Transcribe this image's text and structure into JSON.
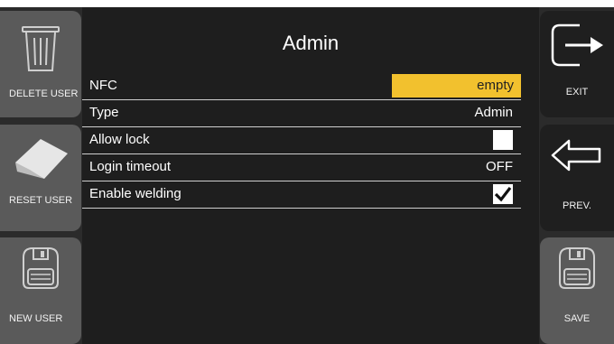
{
  "screen_title": "Admin",
  "left_buttons": [
    {
      "label": "DELETE USER",
      "icon": "trash-icon"
    },
    {
      "label": "RESET USER",
      "icon": "eraser-icon"
    },
    {
      "label": "NEW USER",
      "icon": "floppy-disk-icon"
    }
  ],
  "right_buttons": [
    {
      "label": "EXIT",
      "icon": "exit-arrow-icon"
    },
    {
      "label": "PREV.",
      "icon": "back-arrow-icon"
    },
    {
      "label": "SAVE",
      "icon": "floppy-disk-icon"
    }
  ],
  "settings": [
    {
      "name": "NFC",
      "value": "empty"
    },
    {
      "name": "Type",
      "value": "Admin"
    },
    {
      "name": "Allow lock",
      "value": false
    },
    {
      "name": "Login timeout",
      "value": "OFF"
    },
    {
      "name": "Enable welding",
      "value": true
    }
  ],
  "colors": {
    "highlight": "#f2c12e",
    "button": "#5a5a5a",
    "button_active": "#1f1f1f",
    "panel": "#1e1e1e"
  }
}
